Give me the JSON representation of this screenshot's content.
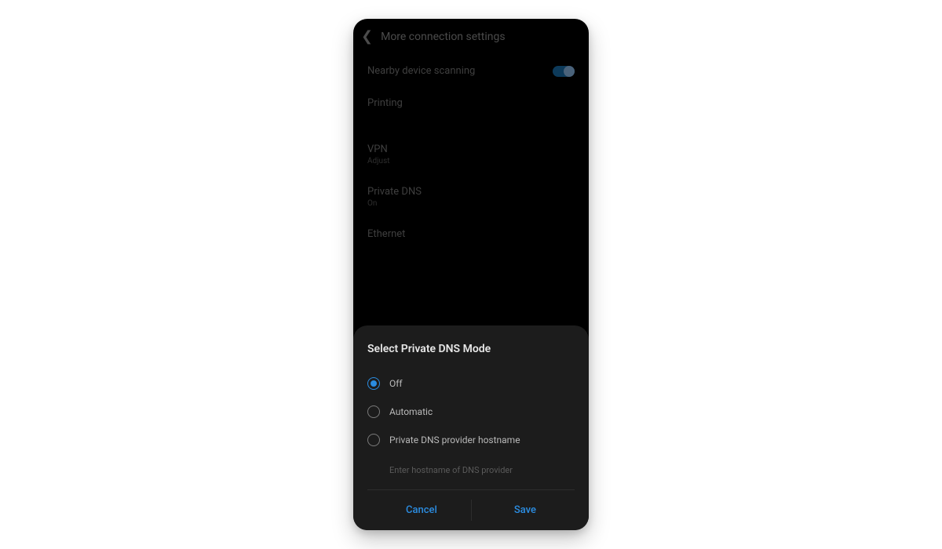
{
  "topbar": {
    "title": "More connection settings"
  },
  "list": {
    "nearby": {
      "label": "Nearby device scanning"
    },
    "printing": {
      "label": "Printing"
    },
    "vpn": {
      "label": "VPN",
      "sub": "Adjust"
    },
    "privateDns": {
      "label": "Private DNS",
      "sub": "On"
    },
    "ethernet": {
      "label": "Ethernet"
    }
  },
  "dialog": {
    "title": "Select Private DNS Mode",
    "options": {
      "off": {
        "label": "Off"
      },
      "auto": {
        "label": "Automatic"
      },
      "hostname": {
        "label": "Private DNS provider hostname"
      }
    },
    "hostnamePlaceholder": "Enter hostname of DNS provider",
    "cancel": "Cancel",
    "save": "Save"
  }
}
